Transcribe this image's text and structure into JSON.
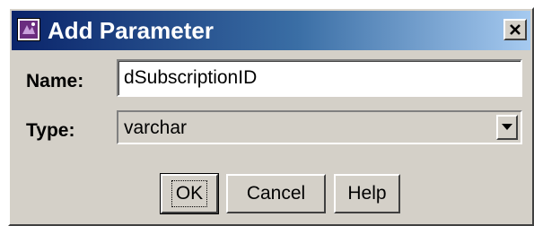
{
  "window": {
    "title": "Add Parameter",
    "icon": "app-icon",
    "close_icon": "close-icon",
    "titlebar_color": "#0a246a"
  },
  "form": {
    "name_label": "Name:",
    "name_value": "dSubscriptionID",
    "type_label": "Type:",
    "type_value": "varchar"
  },
  "buttons": {
    "ok": "OK",
    "cancel": "Cancel",
    "help": "Help"
  }
}
